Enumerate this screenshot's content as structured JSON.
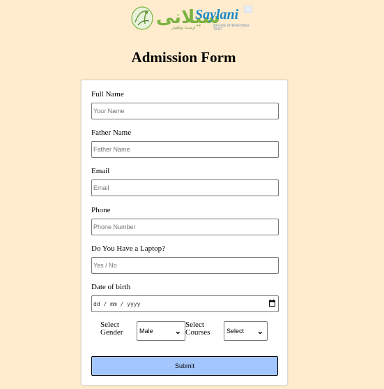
{
  "logo": {
    "urdu": "سیلانی",
    "english": "Saylani",
    "sub_urdu": "ٹرسٹ ویلفیئر",
    "sub_english": "WELFARE INTERNATIONAL TRUST"
  },
  "page_title": "Admission Form",
  "form": {
    "full_name": {
      "label": "Full Name",
      "placeholder": "Your Name"
    },
    "father_name": {
      "label": "Father Name",
      "placeholder": "Father Name"
    },
    "email": {
      "label": "Email",
      "placeholder": "Email"
    },
    "phone": {
      "label": "Phone",
      "placeholder": "Phone Number"
    },
    "laptop": {
      "label": "Do You Have a Laptop?",
      "placeholder": "Yes / No"
    },
    "dob": {
      "label": "Date of birth",
      "placeholder": "dd / mm / yyyy"
    },
    "gender": {
      "label_line1": "Select",
      "label_line2": "Gender",
      "value": "Male"
    },
    "courses": {
      "label_line1": "Select",
      "label_line2": "Courses",
      "value": "Select"
    },
    "submit_label": "Submit"
  },
  "icons": {
    "calendar": "calendar-icon",
    "chevron": "chevron-down-icon"
  }
}
